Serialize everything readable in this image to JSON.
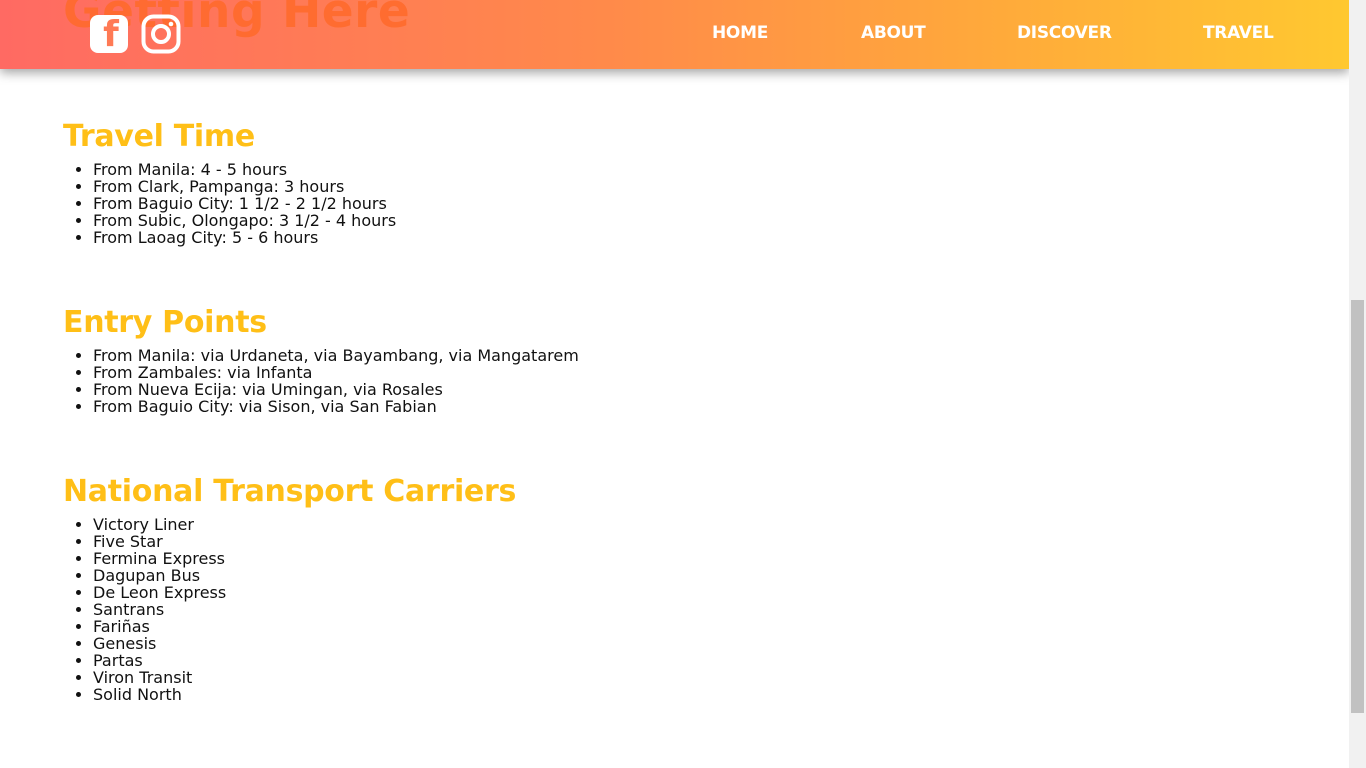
{
  "header": {
    "ghost_title": "Getting Here",
    "social": {
      "facebook_glyph": "f",
      "facebook_icon": "facebook-icon",
      "instagram_icon": "instagram-icon"
    },
    "nav": [
      "HOME",
      "ABOUT",
      "DISCOVER",
      "TRAVEL"
    ]
  },
  "sections": [
    {
      "title": "Travel Time",
      "items": [
        "From Manila: 4 - 5 hours",
        "From Clark, Pampanga: 3 hours",
        "From Baguio City: 1 1/2 - 2 1/2 hours",
        "From Subic, Olongapo: 3 1/2 - 4 hours",
        "From Laoag City: 5 - 6 hours"
      ]
    },
    {
      "title": "Entry Points",
      "items": [
        "From Manila: via Urdaneta, via Bayambang, via Mangatarem",
        "From Zambales: via Infanta",
        "From Nueva Ecija: via Umingan, via Rosales",
        "From Baguio City: via Sison, via San Fabian"
      ]
    },
    {
      "title": "National Transport Carriers",
      "items": [
        "Victory Liner",
        "Five Star",
        "Fermina Express",
        "Dagupan Bus",
        "De Leon Express",
        "Santrans",
        "Fariñas",
        "Genesis",
        "Partas",
        "Viron Transit",
        "Solid North"
      ]
    }
  ],
  "colors": {
    "header_gradient_start": "#ff6a63",
    "header_gradient_end": "#ffc830",
    "heading": "#ffbf17",
    "body_text": "#111111"
  }
}
